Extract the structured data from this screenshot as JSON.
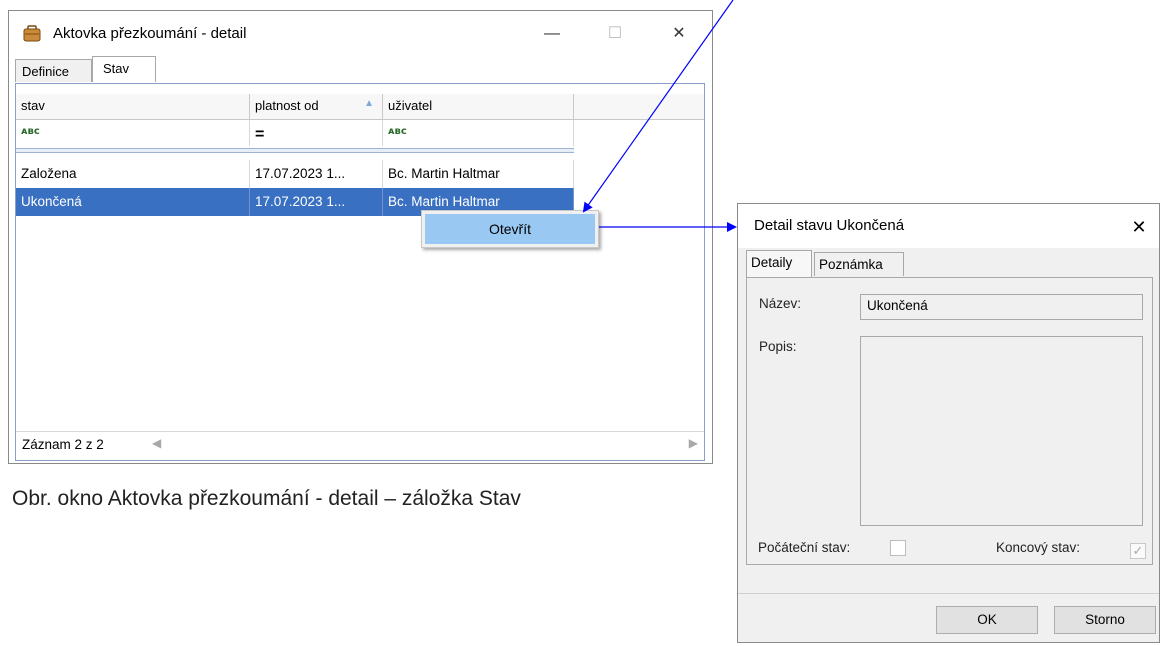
{
  "window1": {
    "title": "Aktovka přezkoumání - detail",
    "controls": {
      "minimize": "—",
      "maximize": "☐",
      "close": "✕"
    },
    "tabs": [
      "Definice",
      "Stav"
    ],
    "active_tab": "Stav",
    "columns": [
      "stav",
      "platnost od",
      "uživatel"
    ],
    "filters": [
      "ᴀʙᴄ",
      "=",
      "ᴀʙᴄ"
    ],
    "rows": [
      [
        "Založena",
        "17.07.2023 1...",
        "Bc. Martin Haltmar"
      ],
      [
        "Ukončená",
        "17.07.2023 1...",
        "Bc. Martin Haltmar"
      ]
    ],
    "selected_row": 1,
    "record_counter": "Záznam 2 z 2"
  },
  "context_menu": {
    "item": "Otevřít"
  },
  "caption": "Obr. okno Aktovka přezkoumání - detail – záložka Stav",
  "window2": {
    "title": "Detail stavu Ukončená",
    "close": "✕",
    "tabs": [
      "Detaily",
      "Poznámka"
    ],
    "active_tab": "Detaily",
    "name_label": "Název:",
    "name_value": "Ukončená",
    "desc_label": "Popis:",
    "desc_value": "",
    "initial_label": "Počáteční stav:",
    "initial_checked": false,
    "final_label": "Koncový stav:",
    "final_checked": true,
    "ok_label": "OK",
    "cancel_label": "Storno"
  },
  "colors": {
    "selection": "#3a70c2",
    "menu_highlight": "#99c9f2",
    "arrow": "#0000ff"
  }
}
